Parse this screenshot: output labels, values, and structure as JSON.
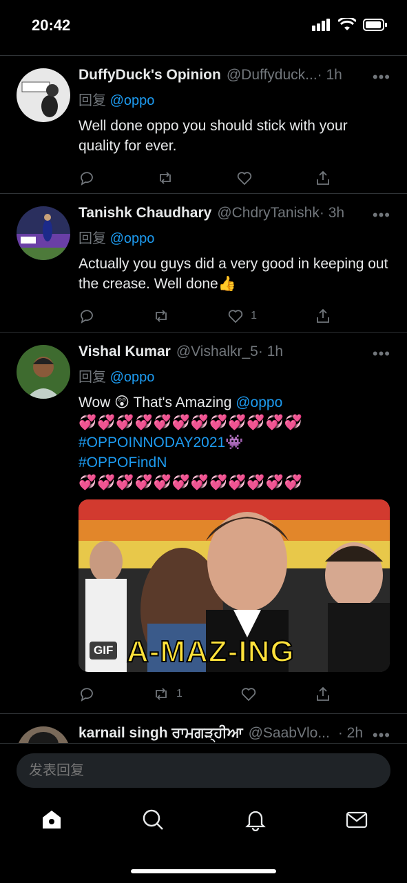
{
  "status_bar": {
    "time": "20:42"
  },
  "tweets": [
    {
      "name": "DuffyDuck's Opinion",
      "handle": "@Duffyduck...",
      "time": "· 1h",
      "reply_prefix": "回复",
      "reply_to": "@oppo",
      "text": "Well done oppo you should stick with your quality for ever.",
      "likes": "",
      "retweets": ""
    },
    {
      "name": "Tanishk Chaudhary",
      "handle": "@ChdryTanishk",
      "time": "· 3h",
      "reply_prefix": "回复",
      "reply_to": "@oppo",
      "text": "Actually you guys did a very good in keeping out the crease. Well done👍",
      "likes": "1",
      "retweets": ""
    },
    {
      "name": "Vishal Kumar",
      "handle": "@Vishalkr_5",
      "time": "· 1h",
      "reply_prefix": "回复",
      "reply_to": "@oppo",
      "text_part1": "Wow 😲 That's Amazing ",
      "text_mention": "@oppo",
      "hearts_line": "💞💞💞💞💞💞💞💞💞💞💞💞",
      "hashtag1": "#OPPOINNODAY2021",
      "hashtag1_emoji": "👾",
      "hashtag2": "#OPPOFindN",
      "gif_label": "GIF",
      "gif_caption": "A-MAZ-ING",
      "retweets": "1",
      "likes": ""
    },
    {
      "name": "karnail singh ਰਾਮਗੜ੍ਹੀਆ",
      "handle": "@SaabVlo...",
      "time": "· 2h"
    }
  ],
  "more_glyph": "•••",
  "reply_box": {
    "placeholder": "发表回复"
  },
  "tabs": [
    {
      "icon": "home-icon"
    },
    {
      "icon": "search-icon"
    },
    {
      "icon": "bell-icon"
    },
    {
      "icon": "mail-icon"
    }
  ],
  "colors": {
    "background": "#000000",
    "accent": "#1d9bf0",
    "muted": "#71767b",
    "text": "#e7e9ea"
  }
}
